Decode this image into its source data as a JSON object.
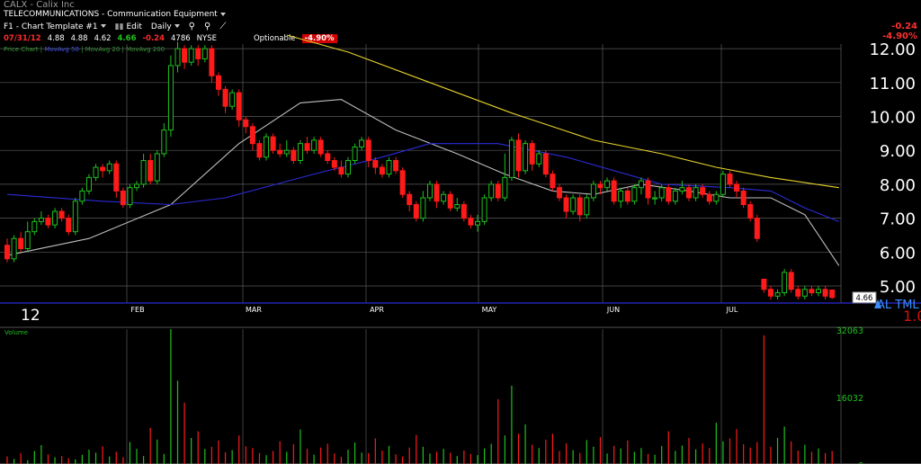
{
  "header": {
    "ticker_line": "CALX - Calix Inc",
    "sector_line": "TELECOMMUNICATIONS - Communication Equipment",
    "toolbar": {
      "template": "F1 - Chart Template #1",
      "edit": "Edit",
      "period": "Daily"
    },
    "quote": {
      "date": "07/31/12",
      "open": "4.88",
      "high": "4.88",
      "low": "4.62",
      "close": "4.66",
      "change": "-0.24",
      "volume": "4786",
      "exchange": "NYSE",
      "optionable": "Optionable",
      "pct": "-4.90%"
    },
    "right_change": "-0.24",
    "right_pct": "-4.90%"
  },
  "legend": {
    "price": "Price Chart",
    "ma50": "MovAvg 50",
    "ma20": "MovAvg 20",
    "ma200": "MovAvg 200"
  },
  "colors": {
    "up": "#1fc21f",
    "down": "#ff1a1a",
    "ma20": "#bdbdbd",
    "ma50": "#2b2bd6",
    "ma200": "#e5d22a",
    "grid": "#5a5a5a",
    "axis": "#ffffff"
  },
  "chart_data": {
    "type": "candlestick",
    "price_axis": {
      "ticks": [
        "12.00",
        "11.00",
        "10.00",
        "9.00",
        "8.00",
        "7.00",
        "6.00",
        "5.00"
      ],
      "ylim": [
        4.6,
        12.2
      ]
    },
    "month_labels": [
      "FEB",
      "MAR",
      "APR",
      "MAY",
      "JUN",
      "JUL"
    ],
    "year_label": "12",
    "last_price_label": "4.66",
    "price_watermark": "AL TML",
    "price_watermark_scale": "1.0",
    "volume_axis": {
      "label": "Volume",
      "ticks": [
        "32063",
        "16032",
        "0"
      ]
    },
    "candles": [
      [
        6.2,
        5.8,
        6.4,
        5.7
      ],
      [
        5.8,
        6.4,
        6.5,
        5.7
      ],
      [
        6.4,
        6.1,
        6.6,
        6.0
      ],
      [
        6.1,
        6.6,
        6.9,
        6.0
      ],
      [
        6.6,
        6.9,
        7.0,
        6.5
      ],
      [
        6.9,
        7.0,
        7.2,
        6.8
      ],
      [
        7.0,
        6.8,
        7.1,
        6.7
      ],
      [
        6.8,
        7.2,
        7.3,
        6.7
      ],
      [
        7.2,
        7.0,
        7.3,
        6.9
      ],
      [
        7.0,
        6.6,
        7.1,
        6.5
      ],
      [
        6.6,
        7.5,
        7.6,
        6.5
      ],
      [
        7.5,
        7.8,
        7.9,
        7.4
      ],
      [
        7.8,
        8.2,
        8.3,
        7.7
      ],
      [
        8.2,
        8.5,
        8.6,
        8.1
      ],
      [
        8.5,
        8.4,
        8.6,
        8.2
      ],
      [
        8.4,
        8.6,
        8.7,
        8.3
      ],
      [
        8.6,
        7.8,
        8.7,
        7.6
      ],
      [
        7.8,
        7.4,
        7.9,
        7.3
      ],
      [
        7.4,
        7.9,
        8.0,
        7.3
      ],
      [
        7.9,
        8.0,
        8.1,
        7.8
      ],
      [
        8.0,
        8.7,
        8.9,
        7.9
      ],
      [
        8.7,
        8.1,
        8.9,
        8.0
      ],
      [
        8.1,
        8.9,
        9.0,
        8.0
      ],
      [
        8.9,
        9.6,
        9.8,
        8.8
      ],
      [
        9.6,
        11.5,
        11.8,
        9.4
      ],
      [
        11.5,
        12.0,
        12.2,
        11.3
      ],
      [
        12.0,
        11.6,
        12.1,
        11.4
      ],
      [
        11.6,
        12.0,
        12.1,
        11.5
      ],
      [
        12.0,
        11.7,
        12.1,
        11.5
      ],
      [
        11.7,
        12.0,
        12.1,
        11.6
      ],
      [
        12.0,
        11.2,
        12.1,
        11.0
      ],
      [
        11.2,
        10.8,
        11.3,
        10.6
      ],
      [
        10.8,
        10.3,
        10.9,
        10.1
      ],
      [
        10.3,
        10.7,
        10.8,
        10.2
      ],
      [
        10.7,
        9.9,
        10.8,
        9.7
      ],
      [
        9.9,
        9.7,
        10.0,
        9.5
      ],
      [
        9.7,
        9.2,
        9.8,
        9.0
      ],
      [
        9.2,
        8.8,
        9.3,
        8.7
      ],
      [
        8.8,
        9.4,
        9.5,
        8.7
      ],
      [
        9.4,
        9.0,
        9.5,
        8.9
      ],
      [
        9.0,
        8.9,
        9.2,
        8.8
      ],
      [
        8.9,
        9.0,
        9.3,
        8.8
      ],
      [
        9.0,
        8.7,
        9.1,
        8.6
      ],
      [
        8.7,
        9.2,
        9.3,
        8.6
      ],
      [
        9.2,
        9.0,
        9.4,
        8.9
      ],
      [
        9.0,
        9.3,
        9.4,
        8.9
      ],
      [
        9.3,
        8.9,
        9.4,
        8.8
      ],
      [
        8.9,
        8.7,
        9.0,
        8.6
      ],
      [
        8.7,
        8.5,
        8.8,
        8.4
      ],
      [
        8.5,
        8.3,
        8.7,
        8.2
      ],
      [
        8.3,
        8.7,
        8.8,
        8.2
      ],
      [
        8.7,
        9.1,
        9.2,
        8.6
      ],
      [
        9.1,
        9.3,
        9.4,
        9.0
      ],
      [
        9.3,
        8.7,
        9.4,
        8.5
      ],
      [
        8.7,
        8.5,
        8.8,
        8.3
      ],
      [
        8.5,
        8.3,
        8.6,
        8.2
      ],
      [
        8.3,
        8.7,
        8.8,
        8.2
      ],
      [
        8.7,
        8.4,
        8.8,
        8.3
      ],
      [
        8.4,
        7.7,
        8.5,
        7.6
      ],
      [
        7.7,
        7.4,
        7.8,
        7.2
      ],
      [
        7.4,
        7.0,
        7.5,
        6.9
      ],
      [
        7.0,
        7.6,
        7.8,
        6.9
      ],
      [
        7.6,
        8.0,
        8.1,
        7.5
      ],
      [
        8.0,
        7.5,
        8.1,
        7.3
      ],
      [
        7.5,
        7.7,
        7.8,
        7.4
      ],
      [
        7.7,
        7.3,
        7.8,
        7.2
      ],
      [
        7.3,
        7.4,
        7.6,
        7.2
      ],
      [
        7.4,
        7.0,
        7.5,
        6.9
      ],
      [
        7.0,
        6.8,
        7.1,
        6.7
      ],
      [
        6.8,
        6.9,
        7.1,
        6.6
      ],
      [
        6.9,
        7.6,
        7.7,
        6.8
      ],
      [
        7.6,
        8.0,
        8.1,
        7.5
      ],
      [
        8.0,
        7.6,
        8.1,
        7.5
      ],
      [
        7.6,
        8.2,
        8.9,
        7.5
      ],
      [
        8.2,
        9.3,
        9.4,
        8.1
      ],
      [
        9.3,
        8.4,
        9.5,
        8.2
      ],
      [
        8.4,
        9.2,
        9.3,
        8.3
      ],
      [
        9.2,
        8.6,
        9.3,
        8.4
      ],
      [
        8.6,
        8.9,
        9.0,
        8.5
      ],
      [
        8.9,
        8.3,
        9.0,
        8.2
      ],
      [
        8.3,
        7.9,
        8.4,
        7.8
      ],
      [
        7.9,
        7.6,
        8.0,
        7.5
      ],
      [
        7.6,
        7.2,
        7.7,
        7.0
      ],
      [
        7.2,
        7.6,
        7.7,
        7.1
      ],
      [
        7.6,
        7.1,
        7.7,
        6.9
      ],
      [
        7.1,
        7.6,
        7.7,
        7.0
      ],
      [
        7.6,
        8.0,
        8.1,
        7.5
      ],
      [
        8.0,
        7.9,
        8.1,
        7.7
      ],
      [
        7.9,
        8.1,
        8.2,
        7.8
      ],
      [
        8.1,
        7.5,
        8.2,
        7.4
      ],
      [
        7.5,
        7.8,
        7.9,
        7.3
      ],
      [
        7.8,
        7.5,
        7.9,
        7.4
      ],
      [
        7.5,
        7.9,
        8.0,
        7.4
      ],
      [
        7.9,
        8.1,
        8.2,
        7.7
      ],
      [
        8.1,
        7.6,
        8.2,
        7.4
      ],
      [
        7.6,
        7.6,
        7.8,
        7.4
      ],
      [
        7.6,
        7.9,
        8.0,
        7.5
      ],
      [
        7.9,
        7.5,
        8.0,
        7.4
      ],
      [
        7.5,
        7.8,
        7.9,
        7.4
      ],
      [
        7.8,
        7.9,
        8.1,
        7.7
      ],
      [
        7.9,
        7.6,
        8.0,
        7.5
      ],
      [
        7.6,
        7.9,
        8.0,
        7.5
      ],
      [
        7.9,
        7.7,
        8.0,
        7.6
      ],
      [
        7.7,
        7.5,
        7.8,
        7.4
      ],
      [
        7.5,
        7.7,
        7.8,
        7.4
      ],
      [
        7.7,
        8.3,
        8.4,
        7.6
      ],
      [
        8.3,
        8.0,
        8.4,
        7.9
      ],
      [
        8.0,
        7.8,
        8.1,
        7.6
      ],
      [
        7.8,
        7.4,
        7.9,
        7.3
      ],
      [
        7.4,
        7.0,
        7.5,
        6.9
      ],
      [
        7.0,
        6.4,
        7.1,
        6.3
      ],
      [
        5.2,
        4.9,
        5.1,
        4.8
      ],
      [
        4.9,
        4.7,
        5.0,
        4.6
      ],
      [
        4.7,
        4.8,
        4.9,
        4.6
      ],
      [
        4.8,
        5.4,
        5.5,
        4.7
      ],
      [
        5.4,
        4.9,
        5.5,
        4.8
      ],
      [
        4.9,
        4.7,
        5.0,
        4.6
      ],
      [
        4.7,
        4.9,
        5.0,
        4.6
      ],
      [
        4.9,
        4.8,
        5.0,
        4.7
      ],
      [
        4.8,
        4.9,
        5.0,
        4.7
      ],
      [
        4.9,
        4.7,
        5.0,
        4.6
      ],
      [
        4.88,
        4.66,
        4.88,
        4.62
      ]
    ],
    "ma20": [
      [
        0,
        5.9
      ],
      [
        12,
        6.4
      ],
      [
        24,
        7.4
      ],
      [
        34,
        9.2
      ],
      [
        43,
        10.4
      ],
      [
        49,
        10.5
      ],
      [
        57,
        9.6
      ],
      [
        66,
        8.9
      ],
      [
        73,
        8.3
      ],
      [
        80,
        7.8
      ],
      [
        86,
        7.7
      ],
      [
        93,
        8.0
      ],
      [
        100,
        7.8
      ],
      [
        106,
        7.6
      ],
      [
        112,
        7.6
      ],
      [
        117,
        7.1
      ],
      [
        122,
        5.6
      ]
    ],
    "ma50": [
      [
        0,
        7.7
      ],
      [
        14,
        7.5
      ],
      [
        24,
        7.4
      ],
      [
        32,
        7.6
      ],
      [
        45,
        8.3
      ],
      [
        55,
        8.8
      ],
      [
        62,
        9.2
      ],
      [
        72,
        9.2
      ],
      [
        82,
        8.8
      ],
      [
        96,
        8.0
      ],
      [
        106,
        7.9
      ],
      [
        112,
        7.8
      ],
      [
        117,
        7.3
      ],
      [
        122,
        6.9
      ]
    ],
    "ma200": [
      [
        41,
        12.4
      ],
      [
        50,
        11.9
      ],
      [
        62,
        11.0
      ],
      [
        74,
        10.1
      ],
      [
        86,
        9.3
      ],
      [
        96,
        8.9
      ],
      [
        104,
        8.5
      ],
      [
        112,
        8.2
      ],
      [
        122,
        7.9
      ]
    ],
    "volumes": [
      1800,
      1200,
      2600,
      900,
      3100,
      4500,
      2300,
      1600,
      1900,
      1400,
      1100,
      2200,
      3400,
      2700,
      4200,
      1800,
      2900,
      1600,
      5200,
      3600,
      1900,
      8600,
      5800,
      2400,
      32063,
      19800,
      14600,
      6200,
      7800,
      3600,
      4100,
      5600,
      2800,
      3300,
      6800,
      4200,
      3800,
      2600,
      2100,
      3100,
      5400,
      2900,
      4700,
      8200,
      3600,
      2200,
      3900,
      4800,
      2500,
      1700,
      3400,
      5100,
      2700,
      2600,
      6100,
      3200,
      4300,
      2300,
      1800,
      3900,
      6900,
      4100,
      2500,
      2900,
      3600,
      2700,
      1900,
      3200,
      2400,
      2100,
      3700,
      4800,
      15400,
      6800,
      18600,
      7200,
      9400,
      4600,
      3800,
      5800,
      7200,
      3100,
      4900,
      3300,
      2600,
      5700,
      4100,
      6400,
      2500,
      4300,
      3700,
      5600,
      2900,
      3800,
      2400,
      2200,
      4300,
      7800,
      3100,
      4400,
      6200,
      3500,
      4900,
      3800,
      9800,
      5400,
      6100,
      8300,
      4700,
      3900,
      5200,
      30600,
      4100,
      6200,
      8900,
      5400,
      3200,
      4600,
      2900,
      3700,
      2600,
      3100
    ]
  }
}
